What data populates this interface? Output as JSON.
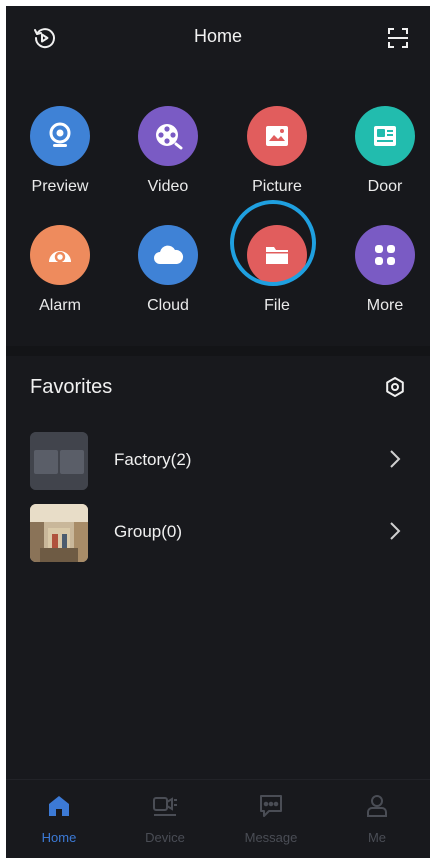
{
  "header": {
    "title": "Home"
  },
  "apps": [
    {
      "label": "Preview",
      "icon": "camera-icon",
      "color": "#3f82d6"
    },
    {
      "label": "Video",
      "icon": "film-reel-icon",
      "color": "#7a5bc4"
    },
    {
      "label": "Picture",
      "icon": "image-icon",
      "color": "#e15d5d"
    },
    {
      "label": "Door",
      "icon": "door-intercom-icon",
      "color": "#22bcae"
    },
    {
      "label": "Alarm",
      "icon": "alarm-icon",
      "color": "#ee8b5d"
    },
    {
      "label": "Cloud",
      "icon": "cloud-icon",
      "color": "#3f82d6"
    },
    {
      "label": "File",
      "icon": "folder-icon",
      "color": "#e15d5d"
    },
    {
      "label": "More",
      "icon": "grid-dots-icon",
      "color": "#7a5bc4"
    }
  ],
  "favorites": {
    "title": "Favorites",
    "items": [
      {
        "label": "Factory(2)"
      },
      {
        "label": "Group(0)"
      }
    ]
  },
  "tabs": [
    {
      "label": "Home",
      "icon": "home-icon",
      "active": true
    },
    {
      "label": "Device",
      "icon": "device-icon",
      "active": false
    },
    {
      "label": "Message",
      "icon": "message-icon",
      "active": false
    },
    {
      "label": "Me",
      "icon": "person-icon",
      "active": false
    }
  ],
  "colors": {
    "accent": "#3c7ad6",
    "highlight_ring": "#1fa0e0",
    "background": "#18191d"
  }
}
